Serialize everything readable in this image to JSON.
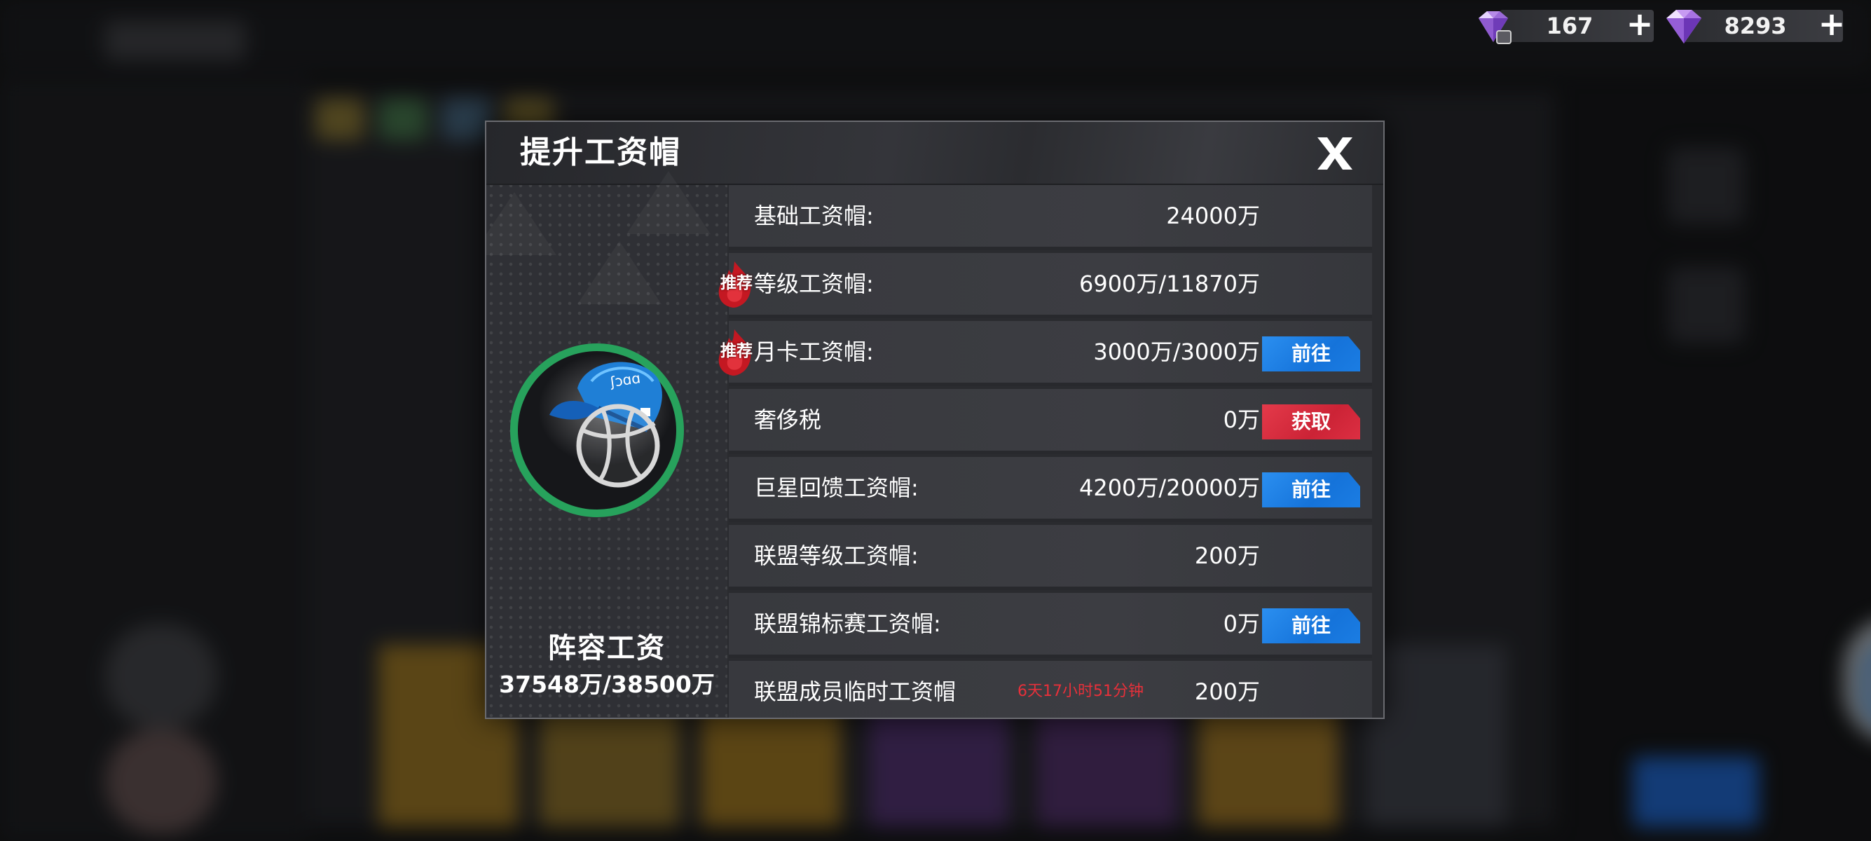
{
  "currencies": [
    {
      "icon": "purple-gem-ticket-icon",
      "value": "167"
    },
    {
      "icon": "purple-diamond-icon",
      "value": "8293"
    }
  ],
  "modal": {
    "title": "提升工资帽",
    "roster": {
      "label": "阵容工资",
      "value": "37548万/38500万"
    },
    "rows": [
      {
        "label": "基础工资帽:",
        "value": "24000万",
        "recommend": false,
        "button": null,
        "timer": null
      },
      {
        "label": "等级工资帽:",
        "value": "6900万/11870万",
        "recommend": true,
        "recommend_text": "推荐",
        "button": null,
        "timer": null
      },
      {
        "label": "月卡工资帽:",
        "value": "3000万/3000万",
        "recommend": true,
        "recommend_text": "推荐",
        "button": {
          "label": "前往",
          "style": "blue"
        },
        "timer": null
      },
      {
        "label": "奢侈税",
        "value": "0万",
        "recommend": false,
        "button": {
          "label": "获取",
          "style": "red"
        },
        "timer": null
      },
      {
        "label": "巨星回馈工资帽:",
        "value": "4200万/20000万",
        "recommend": false,
        "button": {
          "label": "前往",
          "style": "blue"
        },
        "timer": null
      },
      {
        "label": "联盟等级工资帽:",
        "value": "200万",
        "recommend": false,
        "button": null,
        "timer": null
      },
      {
        "label": "联盟锦标赛工资帽:",
        "value": "0万",
        "recommend": false,
        "button": {
          "label": "前往",
          "style": "blue"
        },
        "timer": null
      },
      {
        "label": "联盟成员临时工资帽",
        "value": "200万",
        "recommend": false,
        "button": null,
        "timer": "6天17小时51分钟"
      }
    ]
  },
  "colors": {
    "ring_green": "#27a25c",
    "button_blue": "#1573da",
    "button_red": "#cc2336",
    "timer_red": "#e8303a"
  }
}
